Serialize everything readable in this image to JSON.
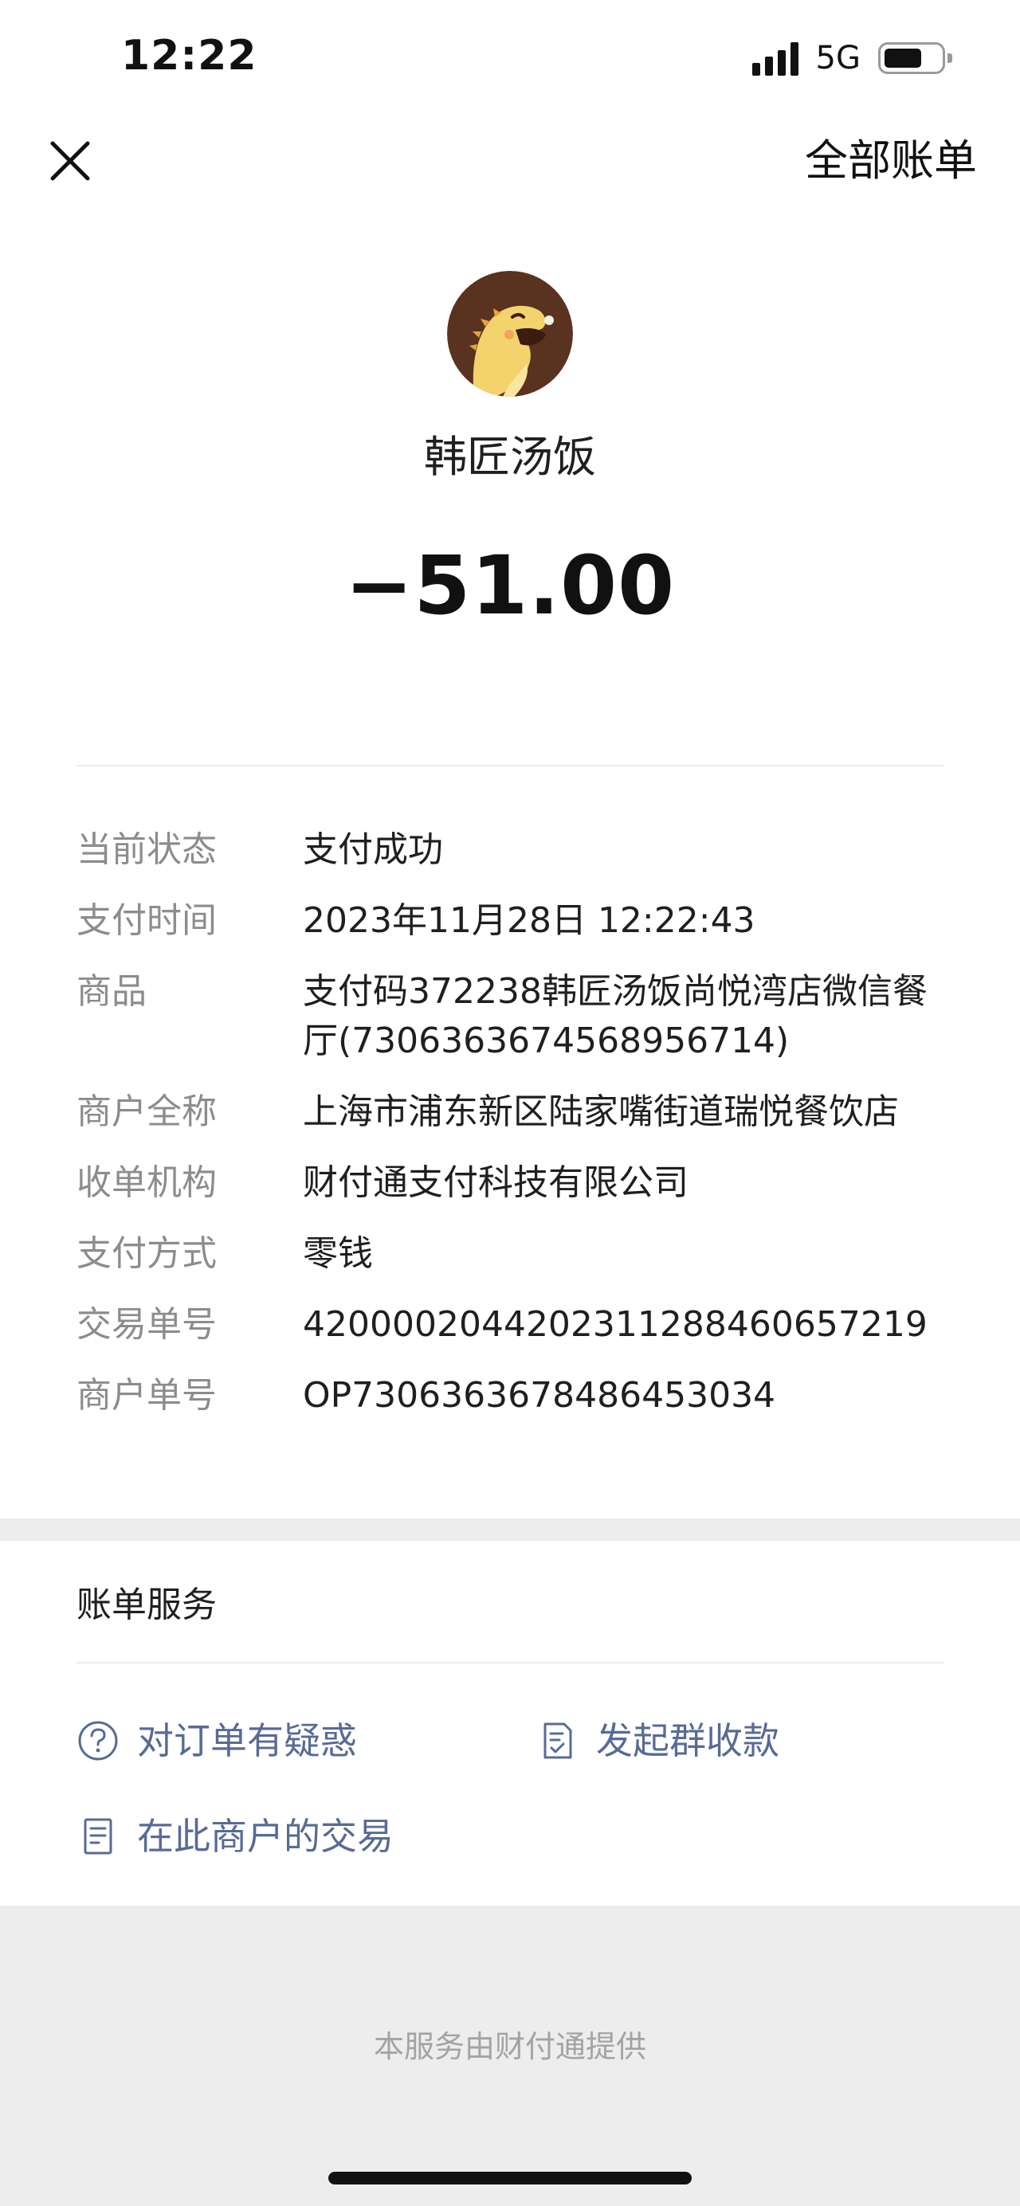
{
  "status_bar": {
    "time": "12:22",
    "network": "5G"
  },
  "nav": {
    "close_icon": "close-icon",
    "all_bills": "全部账单"
  },
  "merchant": {
    "avatar_icon": "dinosaur-avatar",
    "name": "韩匠汤饭",
    "amount": "−51.00"
  },
  "details": [
    {
      "label": "当前状态",
      "value": "支付成功"
    },
    {
      "label": "支付时间",
      "value": "2023年11月28日 12:22:43"
    },
    {
      "label": "商品",
      "value": "支付码372238韩匠汤饭尚悦湾店微信餐厅(7306363674568956714)"
    },
    {
      "label": "商户全称",
      "value": "上海市浦东新区陆家嘴街道瑞悦餐饮店"
    },
    {
      "label": "收单机构",
      "value": "财付通支付科技有限公司"
    },
    {
      "label": "支付方式",
      "value": "零钱"
    },
    {
      "label": "交易单号",
      "value": "4200002044202311288460657219"
    },
    {
      "label": "商户单号",
      "value": "OP7306363678486453034"
    }
  ],
  "services": {
    "title": "账单服务",
    "items": [
      {
        "label": "对订单有疑惑",
        "icon": "question-icon"
      },
      {
        "label": "发起群收款",
        "icon": "group-collect-icon"
      },
      {
        "label": "在此商户的交易",
        "icon": "receipt-icon"
      }
    ]
  },
  "footer": {
    "text": "本服务由财付通提供"
  },
  "colors": {
    "link": "#576b95",
    "label": "#8c8c8c",
    "background": "#ededed"
  }
}
